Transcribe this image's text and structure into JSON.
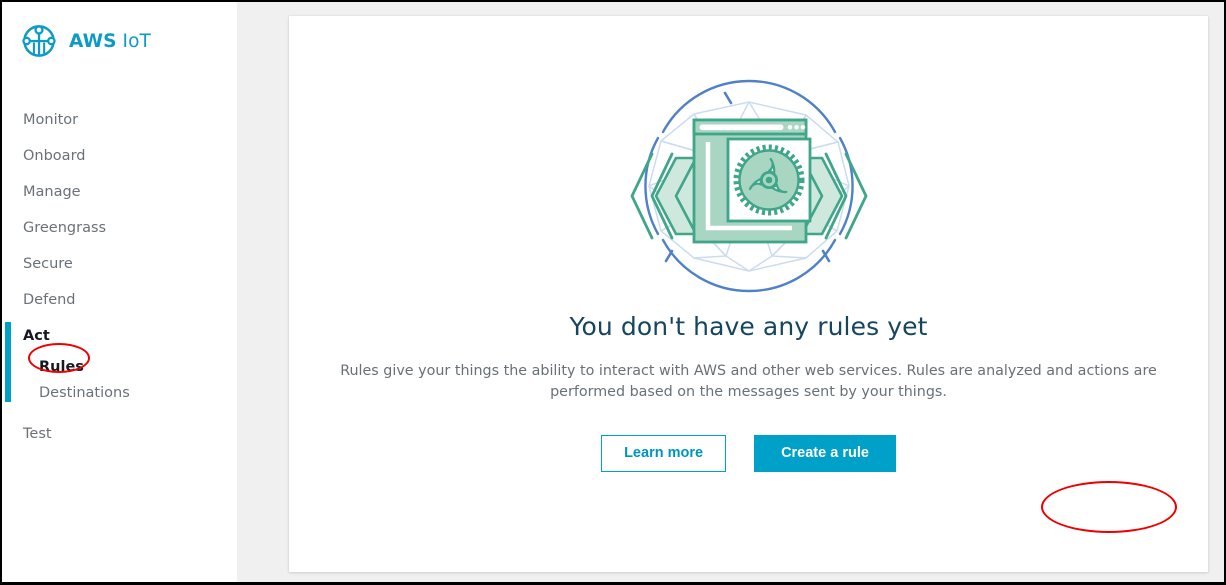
{
  "brand": {
    "logo_icon": "aws-iot-logo-icon",
    "name_bold": "AWS",
    "name_light": " IoT"
  },
  "sidebar": {
    "items": [
      {
        "label": "Monitor",
        "type": "item",
        "active": false
      },
      {
        "label": "Onboard",
        "type": "item",
        "active": false
      },
      {
        "label": "Manage",
        "type": "item",
        "active": false
      },
      {
        "label": "Greengrass",
        "type": "item",
        "active": false
      },
      {
        "label": "Secure",
        "type": "item",
        "active": false
      },
      {
        "label": "Defend",
        "type": "item",
        "active": false
      },
      {
        "label": "Act",
        "type": "section",
        "active": true
      },
      {
        "label": "Rules",
        "type": "sub",
        "active": true
      },
      {
        "label": "Destinations",
        "type": "sub",
        "active": false
      },
      {
        "label": "Test",
        "type": "item",
        "active": false
      }
    ],
    "active_marker_color": "#00a1c9"
  },
  "main": {
    "illustration_icon": "rules-empty-state-illustration",
    "title": "You don't have any rules yet",
    "description": "Rules give your things the ability to interact with AWS and other web services. Rules are analyzed and actions are performed based on the messages sent by your things.",
    "buttons": {
      "secondary_label": "Learn more",
      "primary_label": "Create a rule"
    }
  },
  "annotations": [
    {
      "name": "highlight-rules",
      "shape": "ellipse",
      "color": "#ee0000",
      "target": "Rules"
    },
    {
      "name": "highlight-create-a-rule",
      "shape": "ellipse",
      "color": "#ee0000",
      "target": "Create a rule"
    }
  ],
  "colors": {
    "accent": "#00a1c9",
    "brand_text": "#0b9bc6",
    "title_text": "#16455f",
    "body_text": "#687078",
    "content_bg": "#f0f0f0",
    "annotation": "#ee0000",
    "illustration_green": "#3fa68a",
    "illustration_green_fill": "#b6ddcb",
    "illustration_blue": "#4f81c7",
    "illustration_blue_light": "#ccdcf2"
  }
}
